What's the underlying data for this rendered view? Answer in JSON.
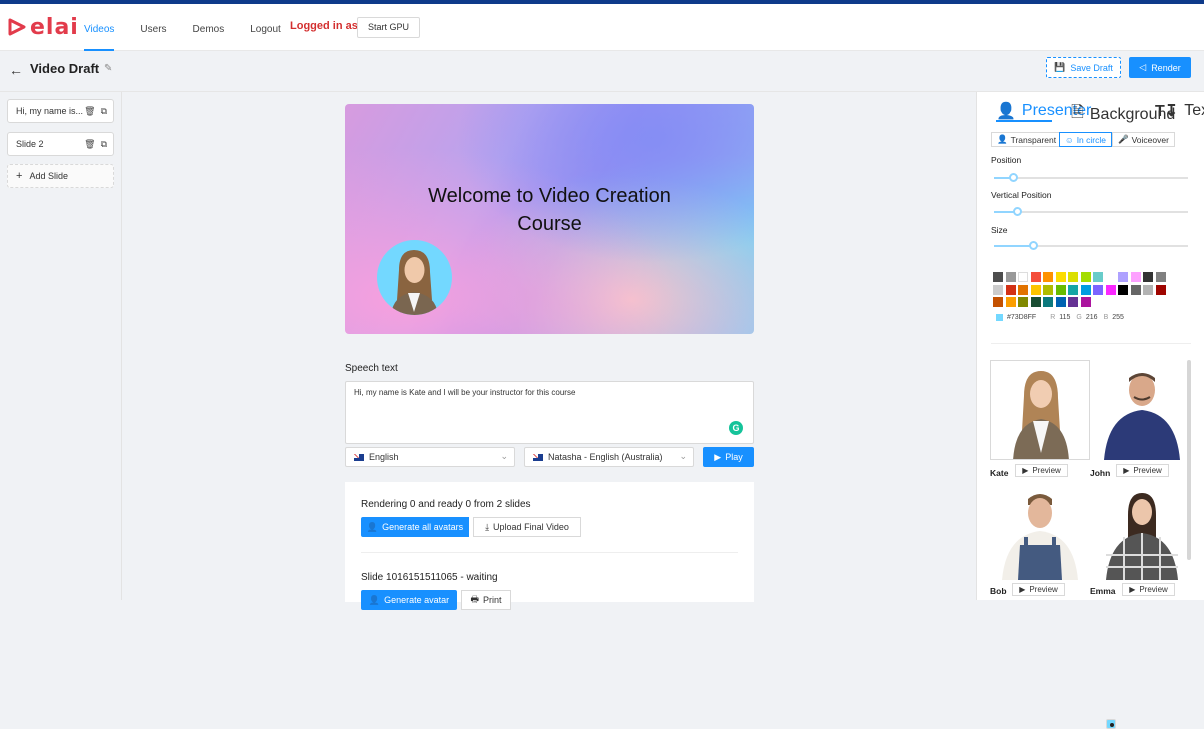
{
  "header": {
    "logo_text": "elai",
    "nav": [
      "Videos",
      "Users",
      "Demos",
      "Logout"
    ],
    "logged_in_label": "Logged in as:",
    "start_gpu": "Start GPU"
  },
  "titlebar": {
    "title": "Video Draft",
    "save_draft": "Save Draft",
    "render": "Render"
  },
  "slides": {
    "items": [
      "Hi, my name is...",
      "Slide 2"
    ],
    "add_slide": "Add Slide"
  },
  "canvas": {
    "title_line1": "Welcome to Video Creation",
    "title_line2": "Course"
  },
  "speech": {
    "label": "Speech text",
    "text": "Hi, my name is Kate and I will be your instructor for this course",
    "language": "English",
    "voice": "Natasha - English (Australia)",
    "play": "Play"
  },
  "rendering": {
    "status": "Rendering 0 and ready 0 from 2 slides",
    "generate_all": "Generate all avatars",
    "upload_final": "Upload Final Video",
    "slide_status": "Slide 1016151511065 - waiting",
    "generate_avatar": "Generate avatar",
    "print": "Print"
  },
  "right_panel": {
    "tabs": [
      "Presenter",
      "Background",
      "Text"
    ],
    "modes": [
      "Transparent",
      "In circle",
      "Voiceover"
    ],
    "sliders": [
      {
        "label": "Position",
        "value": 0.1
      },
      {
        "label": "Vertical Position",
        "value": 0.12
      },
      {
        "label": "Size",
        "value": 0.2
      }
    ],
    "color": {
      "hex": "#73D8FF",
      "r_label": "R",
      "r": "115",
      "g_label": "G",
      "g": "216",
      "b_label": "B",
      "b": "255"
    },
    "swatches": [
      "#4d4d4d",
      "#999999",
      "#ffffff",
      "#f44e3b",
      "#fe9200",
      "#fcdc00",
      "#dbdf00",
      "#a4dd00",
      "#68ccca",
      "#73d8ff",
      "#aea1ff",
      "#fda1ff",
      "#333333",
      "#808080",
      "#cccccc",
      "#d33115",
      "#e27300",
      "#fcc400",
      "#b0bc00",
      "#68bc00",
      "#16a5a5",
      "#009ce0",
      "#7b64ff",
      "#fa28ff",
      "#000000",
      "#666666",
      "#b3b3b3",
      "#9f0500",
      "#c45100",
      "#fb9e00",
      "#808900",
      "#194d33",
      "#0c797d",
      "#0062b1",
      "#653294",
      "#ab149e"
    ],
    "presenters": [
      {
        "name": "Kate",
        "preview": "Preview"
      },
      {
        "name": "John",
        "preview": "Preview"
      },
      {
        "name": "Bob",
        "preview": "Preview"
      },
      {
        "name": "Emma",
        "preview": "Preview"
      }
    ]
  }
}
